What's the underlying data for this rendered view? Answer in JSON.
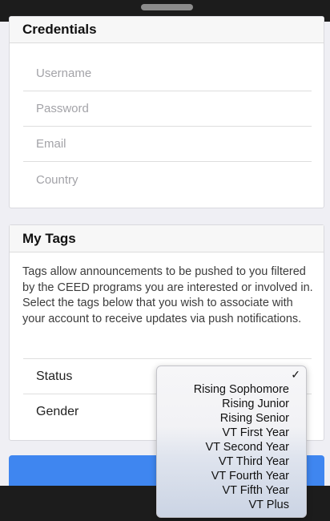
{
  "credentials": {
    "title": "Credentials",
    "fields": [
      {
        "placeholder": "Username"
      },
      {
        "placeholder": "Password"
      },
      {
        "placeholder": "Email"
      },
      {
        "placeholder": "Country"
      }
    ]
  },
  "tags": {
    "title": "My Tags",
    "description": "Tags allow announcements to be pushed to you filtered by the CEED programs you are interested or involved in. Select the tags below that you wish to associate with your account to receive updates via push notifications.",
    "rows": [
      {
        "label": "Status"
      },
      {
        "label": "Gender"
      }
    ]
  },
  "register_button": {
    "label": "Re"
  },
  "picker": {
    "check_icon": "checkmark-icon",
    "check_glyph": "✓",
    "options": [
      "Rising Sophomore",
      "Rising Junior",
      "Rising Senior",
      "VT First Year",
      "VT Second Year",
      "VT Third Year",
      "VT Fourth Year",
      "VT Fifth Year",
      "VT Plus"
    ]
  }
}
